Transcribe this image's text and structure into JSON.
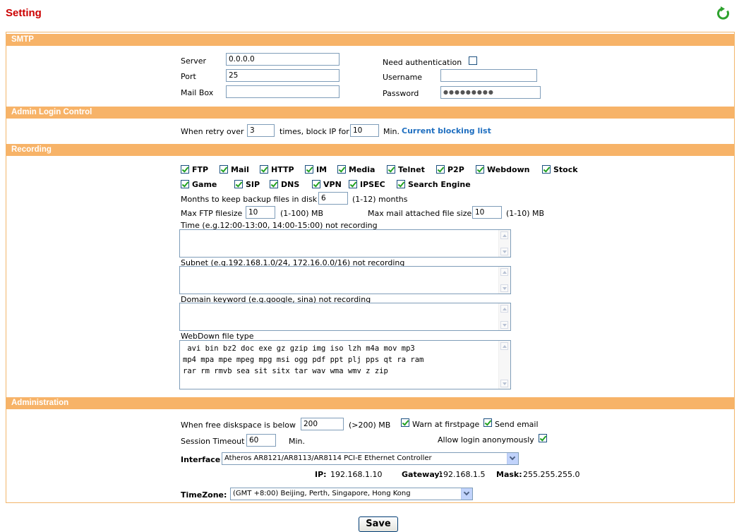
{
  "page": {
    "title": "Setting"
  },
  "icons": {
    "refresh": "refresh-icon"
  },
  "colors": {
    "accent_bar": "#f7b368",
    "title": "#cc0000",
    "link": "#1f6fc0"
  },
  "sections": {
    "smtp": "SMTP",
    "admin_login": "Admin Login Control",
    "recording": "Recording",
    "administration": "Administration"
  },
  "smtp": {
    "server_label": "Server",
    "server_value": "0.0.0.0",
    "port_label": "Port",
    "port_value": "25",
    "mailbox_label": "Mail Box",
    "mailbox_value": "",
    "need_auth_label": "Need authentication",
    "need_auth_checked": false,
    "username_label": "Username",
    "username_value": "",
    "password_label": "Password",
    "password_value": "●●●●●●●●●"
  },
  "admin_login": {
    "retry_prefix": "When retry over",
    "retry_value": "3",
    "times_label": "times, block IP for",
    "block_value": "10",
    "min_label": "Min.",
    "blocking_link": "Current blocking list"
  },
  "recording": {
    "protocols_row1": [
      "FTP",
      "Mail",
      "HTTP",
      "IM",
      "Media",
      "Telnet",
      "P2P",
      "Webdown",
      "Stock"
    ],
    "protocols_row2": [
      "Game",
      "SIP",
      "DNS",
      "VPN",
      "IPSEC",
      "Search Engine"
    ],
    "months_label": "Months to keep backup files in disk",
    "months_value": "6",
    "months_hint": "(1-12) months",
    "ftp_label": "Max FTP filesize",
    "ftp_value": "10",
    "ftp_hint": "(1-100)  MB",
    "mail_label": "Max mail attached file size",
    "mail_value": "10",
    "mail_hint": "(1-10)  MB",
    "time_label": "Time (e.g.12:00-13:00, 14:00-15:00) not recording",
    "subnet_label": "Subnet (e.g.192.168.1.0/24, 172.16.0.0/16) not recording",
    "domain_label": "Domain keyword (e.g.google, sina) not recording",
    "webdown_label": "WebDown file type",
    "webdown_value": " avi bin bz2 doc exe gz gzip img iso lzh m4a mov mp3\nmp4 mpa mpe mpeg mpg msi ogg pdf ppt plj pps qt ra ram\nrar rm rmvb sea sit sitx tar wav wma wmv z zip"
  },
  "administration": {
    "disk_label": "When free diskspace is below",
    "disk_value": "200",
    "disk_hint": "(>200) MB",
    "warn_label": "Warn at firstpage",
    "send_email_label": "Send email",
    "session_label": "Session Timeout",
    "session_value": "60",
    "session_unit": "Min.",
    "anon_label": "Allow login anonymously",
    "interface_label": "Interface",
    "interface_value": "Atheros AR8121/AR8113/AR8114 PCI-E Ethernet Controller",
    "ip_label": "IP:",
    "ip_value": "192.168.1.10",
    "gateway_label": "Gateway:",
    "gateway_value": "192.168.1.5",
    "mask_label": "Mask:",
    "mask_value": "255.255.255.0",
    "timezone_label": "TimeZone:",
    "timezone_value": "(GMT +8:00) Beijing, Perth, Singapore, Hong Kong"
  },
  "footer": {
    "save_label": "Save"
  }
}
